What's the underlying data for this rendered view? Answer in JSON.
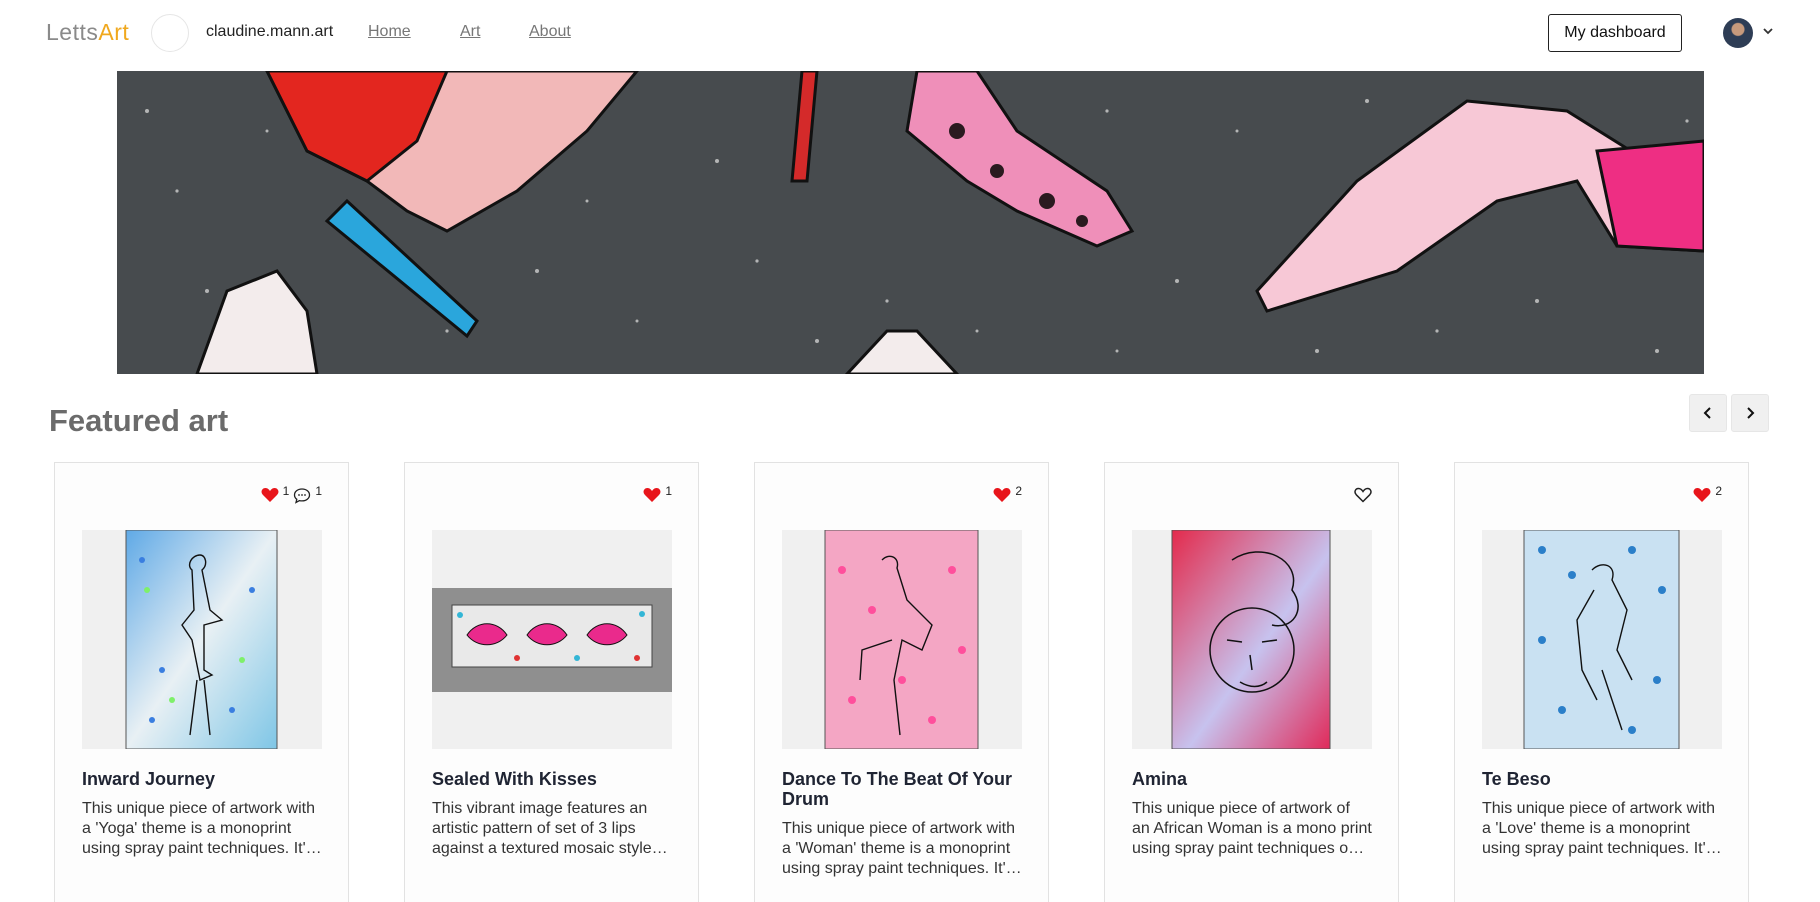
{
  "header": {
    "logo_part1": "Letts",
    "logo_part2": "Art",
    "site_name": "claudine.mann.art",
    "nav": [
      {
        "label": "Home"
      },
      {
        "label": "Art"
      },
      {
        "label": "About"
      }
    ],
    "dashboard_label": "My dashboard"
  },
  "featured": {
    "title": "Featured art",
    "prev_icon": "chevron-left-icon",
    "next_icon": "chevron-right-icon"
  },
  "cards": [
    {
      "title": "Inward Journey",
      "description": "This unique piece of artwork with a 'Yoga' theme is a monoprint using spray paint techniques. It's a one-of-a-kind piece.",
      "likes": "1",
      "comments": "1",
      "liked": true
    },
    {
      "title": "Sealed With Kisses",
      "description": "This vibrant image features an artistic pattern of set of 3 lips against a textured mosaic style background.",
      "likes": "1",
      "liked": true
    },
    {
      "title": "Dance To The Beat Of Your Drum",
      "description": "This unique piece of artwork with a 'Woman' theme is a monoprint using spray paint techniques. It's a one-of-a-kind piece.",
      "likes": "2",
      "liked": true
    },
    {
      "title": "Amina",
      "description": "This unique piece of artwork of an African Woman is a mono print using spray paint techniques on paper.",
      "liked": false
    },
    {
      "title": "Te Beso",
      "description": "This unique piece of artwork with a 'Love' theme is a monoprint using spray paint techniques. It's a one-of-a-kind piece.",
      "likes": "2",
      "liked": true
    }
  ],
  "colors": {
    "accent": "#f0a81e",
    "heart": "#e8151b"
  }
}
